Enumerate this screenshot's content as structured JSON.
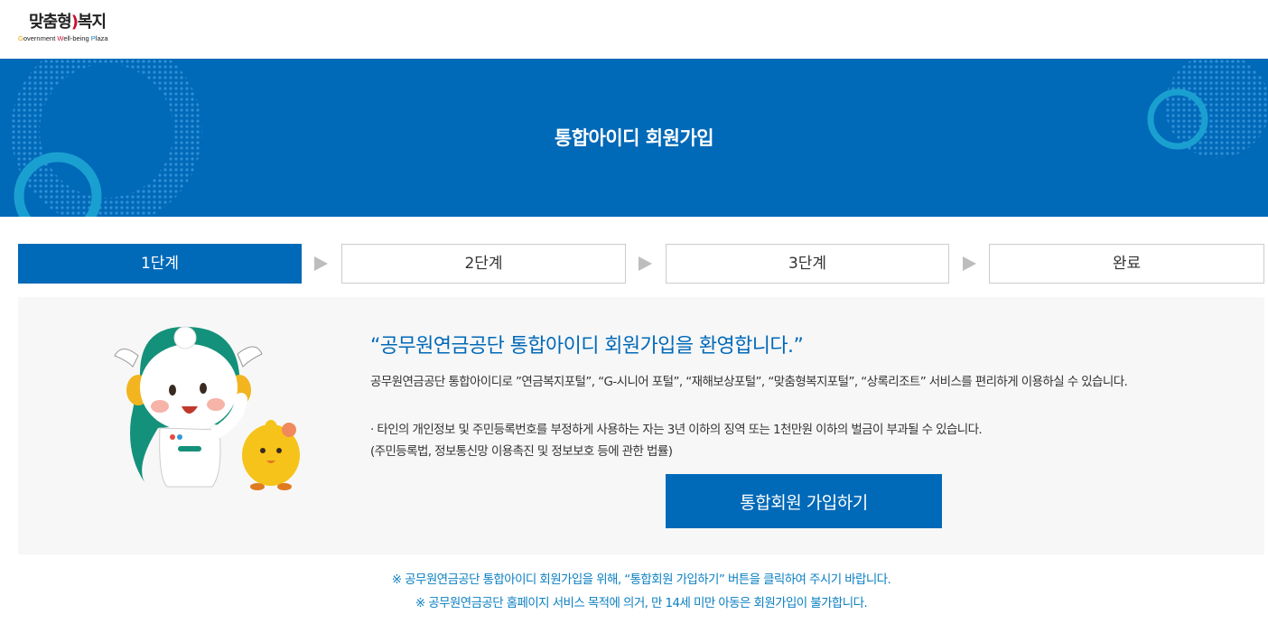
{
  "logo": {
    "ko_part1": "맞춤형",
    "ko_part2": "복지",
    "en_c1": "G",
    "en_r1": "overnment ",
    "en_c2": "W",
    "en_r2": "ell-being ",
    "en_c3": "P",
    "en_r3": "laza"
  },
  "banner": {
    "title": "통합아이디 회원가입"
  },
  "steps": [
    {
      "label": "1단계",
      "active": true
    },
    {
      "label": "2단계",
      "active": false
    },
    {
      "label": "3단계",
      "active": false
    },
    {
      "label": "완료",
      "active": false
    }
  ],
  "panel": {
    "welcome": "“공무원연금공단 통합아이디 회원가입을 환영합니다.”",
    "description": "공무원연금공단 통합아이디로 ”연금복지포털”, “G-시니어 포털”, “재해보상포털”, “맞춤형복지포털”, “상록리조트” 서비스를 편리하게 이용하실 수 있습니다.",
    "warning": "· 타인의 개인정보 및 주민등록번호를 부정하게 사용하는 자는 3년 이하의 징역 또는 1천만원 이하의 벌금이 부과될 수 있습니다.",
    "law_note": "(주민등록법, 정보통신망 이용촉진 및 정보보호 등에 관한 법률)",
    "join_button": "통합회원 가입하기"
  },
  "notes": [
    "※ 공무원연금공단 통합아이디 회원가입을 위해, “통합회원 가입하기” 버튼을 클릭하여 주시기 바랍니다.",
    "※ 공무원연금공단 홈페이지 서비스 목적에 의거, 만 14세 미만 아동은 회원가입이 불가합니다."
  ],
  "colors": {
    "primary": "#0069b8",
    "note_text": "#0a7fc1",
    "panel_bg": "#f7f7f7"
  }
}
